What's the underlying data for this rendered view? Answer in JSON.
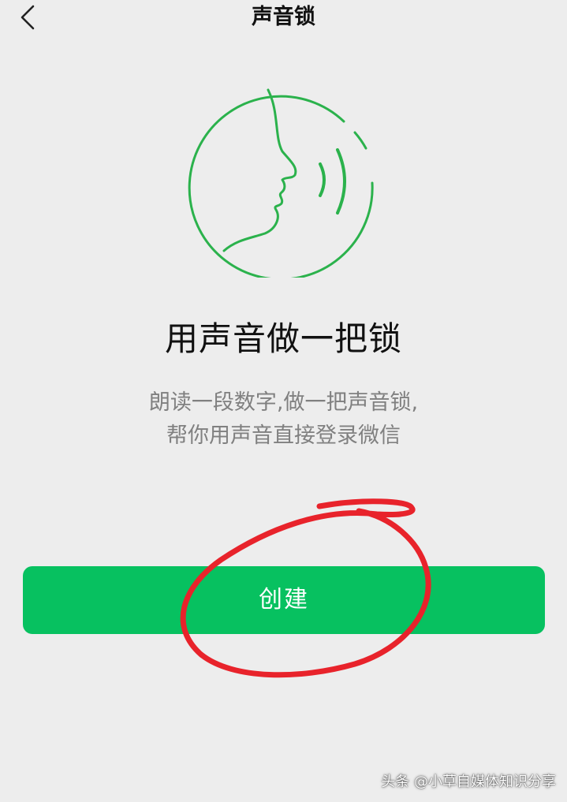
{
  "nav": {
    "title": "声音锁",
    "back_icon": "chevron-left-icon"
  },
  "illustration": {
    "icon": "voice-face-icon",
    "color": "#07c160"
  },
  "main": {
    "headline": "用声音做一把锁",
    "description_line1": "朗读一段数字,做一把声音锁,",
    "description_line2": "帮你用声音直接登录微信"
  },
  "action": {
    "create_label": "创建",
    "color": "#07c160"
  },
  "annotation": {
    "color": "#e8232b"
  },
  "watermark": {
    "text": "头条 @小草自媒体知识分享"
  }
}
